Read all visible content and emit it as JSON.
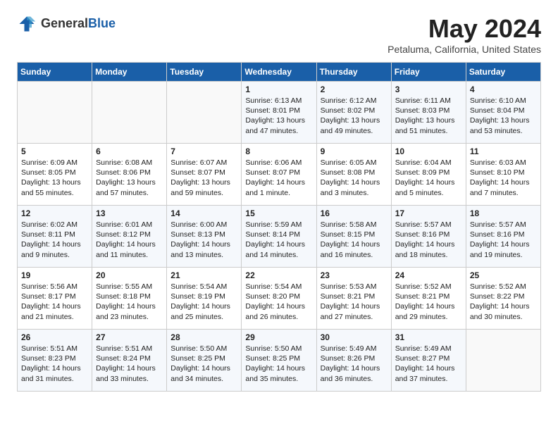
{
  "header": {
    "logo_line1": "General",
    "logo_line2": "Blue",
    "month": "May 2024",
    "location": "Petaluma, California, United States"
  },
  "days_of_week": [
    "Sunday",
    "Monday",
    "Tuesday",
    "Wednesday",
    "Thursday",
    "Friday",
    "Saturday"
  ],
  "weeks": [
    [
      {
        "day": "",
        "info": ""
      },
      {
        "day": "",
        "info": ""
      },
      {
        "day": "",
        "info": ""
      },
      {
        "day": "1",
        "info": "Sunrise: 6:13 AM\nSunset: 8:01 PM\nDaylight: 13 hours and 47 minutes."
      },
      {
        "day": "2",
        "info": "Sunrise: 6:12 AM\nSunset: 8:02 PM\nDaylight: 13 hours and 49 minutes."
      },
      {
        "day": "3",
        "info": "Sunrise: 6:11 AM\nSunset: 8:03 PM\nDaylight: 13 hours and 51 minutes."
      },
      {
        "day": "4",
        "info": "Sunrise: 6:10 AM\nSunset: 8:04 PM\nDaylight: 13 hours and 53 minutes."
      }
    ],
    [
      {
        "day": "5",
        "info": "Sunrise: 6:09 AM\nSunset: 8:05 PM\nDaylight: 13 hours and 55 minutes."
      },
      {
        "day": "6",
        "info": "Sunrise: 6:08 AM\nSunset: 8:06 PM\nDaylight: 13 hours and 57 minutes."
      },
      {
        "day": "7",
        "info": "Sunrise: 6:07 AM\nSunset: 8:07 PM\nDaylight: 13 hours and 59 minutes."
      },
      {
        "day": "8",
        "info": "Sunrise: 6:06 AM\nSunset: 8:07 PM\nDaylight: 14 hours and 1 minute."
      },
      {
        "day": "9",
        "info": "Sunrise: 6:05 AM\nSunset: 8:08 PM\nDaylight: 14 hours and 3 minutes."
      },
      {
        "day": "10",
        "info": "Sunrise: 6:04 AM\nSunset: 8:09 PM\nDaylight: 14 hours and 5 minutes."
      },
      {
        "day": "11",
        "info": "Sunrise: 6:03 AM\nSunset: 8:10 PM\nDaylight: 14 hours and 7 minutes."
      }
    ],
    [
      {
        "day": "12",
        "info": "Sunrise: 6:02 AM\nSunset: 8:11 PM\nDaylight: 14 hours and 9 minutes."
      },
      {
        "day": "13",
        "info": "Sunrise: 6:01 AM\nSunset: 8:12 PM\nDaylight: 14 hours and 11 minutes."
      },
      {
        "day": "14",
        "info": "Sunrise: 6:00 AM\nSunset: 8:13 PM\nDaylight: 14 hours and 13 minutes."
      },
      {
        "day": "15",
        "info": "Sunrise: 5:59 AM\nSunset: 8:14 PM\nDaylight: 14 hours and 14 minutes."
      },
      {
        "day": "16",
        "info": "Sunrise: 5:58 AM\nSunset: 8:15 PM\nDaylight: 14 hours and 16 minutes."
      },
      {
        "day": "17",
        "info": "Sunrise: 5:57 AM\nSunset: 8:16 PM\nDaylight: 14 hours and 18 minutes."
      },
      {
        "day": "18",
        "info": "Sunrise: 5:57 AM\nSunset: 8:16 PM\nDaylight: 14 hours and 19 minutes."
      }
    ],
    [
      {
        "day": "19",
        "info": "Sunrise: 5:56 AM\nSunset: 8:17 PM\nDaylight: 14 hours and 21 minutes."
      },
      {
        "day": "20",
        "info": "Sunrise: 5:55 AM\nSunset: 8:18 PM\nDaylight: 14 hours and 23 minutes."
      },
      {
        "day": "21",
        "info": "Sunrise: 5:54 AM\nSunset: 8:19 PM\nDaylight: 14 hours and 25 minutes."
      },
      {
        "day": "22",
        "info": "Sunrise: 5:54 AM\nSunset: 8:20 PM\nDaylight: 14 hours and 26 minutes."
      },
      {
        "day": "23",
        "info": "Sunrise: 5:53 AM\nSunset: 8:21 PM\nDaylight: 14 hours and 27 minutes."
      },
      {
        "day": "24",
        "info": "Sunrise: 5:52 AM\nSunset: 8:21 PM\nDaylight: 14 hours and 29 minutes."
      },
      {
        "day": "25",
        "info": "Sunrise: 5:52 AM\nSunset: 8:22 PM\nDaylight: 14 hours and 30 minutes."
      }
    ],
    [
      {
        "day": "26",
        "info": "Sunrise: 5:51 AM\nSunset: 8:23 PM\nDaylight: 14 hours and 31 minutes."
      },
      {
        "day": "27",
        "info": "Sunrise: 5:51 AM\nSunset: 8:24 PM\nDaylight: 14 hours and 33 minutes."
      },
      {
        "day": "28",
        "info": "Sunrise: 5:50 AM\nSunset: 8:25 PM\nDaylight: 14 hours and 34 minutes."
      },
      {
        "day": "29",
        "info": "Sunrise: 5:50 AM\nSunset: 8:25 PM\nDaylight: 14 hours and 35 minutes."
      },
      {
        "day": "30",
        "info": "Sunrise: 5:49 AM\nSunset: 8:26 PM\nDaylight: 14 hours and 36 minutes."
      },
      {
        "day": "31",
        "info": "Sunrise: 5:49 AM\nSunset: 8:27 PM\nDaylight: 14 hours and 37 minutes."
      },
      {
        "day": "",
        "info": ""
      }
    ]
  ]
}
